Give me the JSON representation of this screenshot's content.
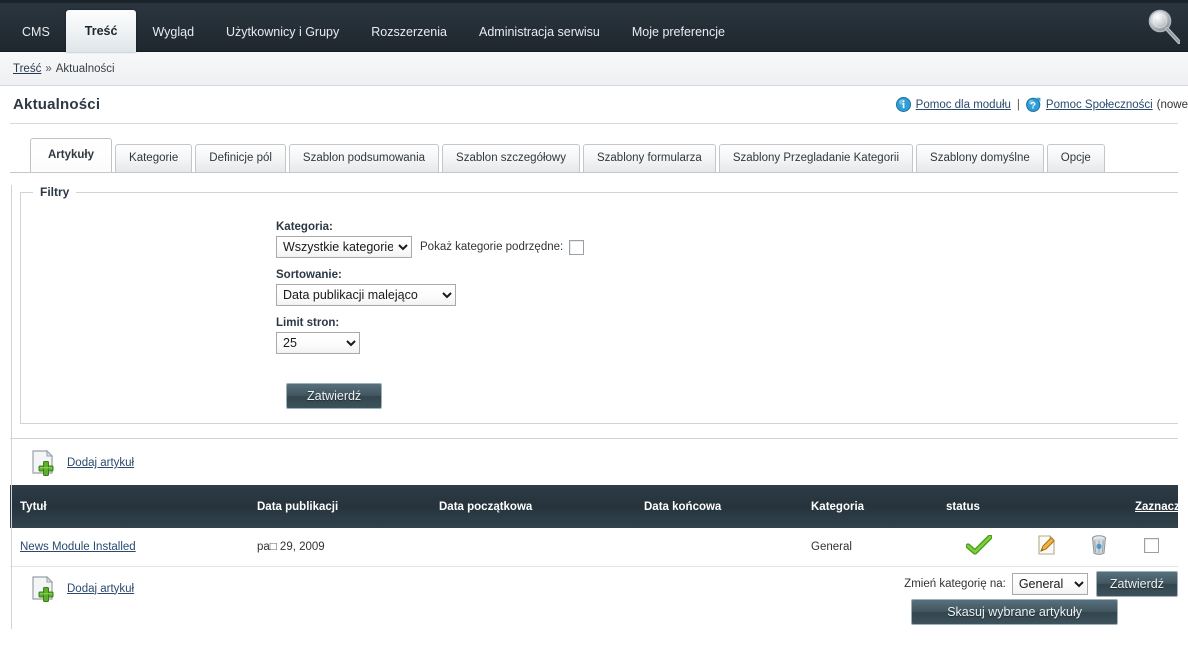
{
  "topnav": {
    "items": [
      {
        "label": "CMS",
        "active": false
      },
      {
        "label": "Treść",
        "active": true
      },
      {
        "label": "Wygląd",
        "active": false
      },
      {
        "label": "Użytkownicy i Grupy",
        "active": false
      },
      {
        "label": "Rozszerzenia",
        "active": false
      },
      {
        "label": "Administracja serwisu",
        "active": false
      },
      {
        "label": "Moje preferencje",
        "active": false
      }
    ],
    "search_icon": "search-icon"
  },
  "breadcrumb": {
    "root": "Treść",
    "separator": "»",
    "current": "Aktualności"
  },
  "header": {
    "title": "Aktualności",
    "help_module": "Pomoc dla modułu",
    "help_separator": "|",
    "help_community": "Pomoc Społeczności",
    "help_community_suffix": "(nowe",
    "info_icon": "info-icon",
    "question_icon": "question-icon"
  },
  "tabs": [
    {
      "label": "Artykuły",
      "active": true
    },
    {
      "label": "Kategorie",
      "active": false
    },
    {
      "label": "Definicje pól",
      "active": false
    },
    {
      "label": "Szablon podsumowania",
      "active": false
    },
    {
      "label": "Szablon szczegółowy",
      "active": false
    },
    {
      "label": "Szablony formularza",
      "active": false
    },
    {
      "label": "Szablony Przegladanie Kategorii",
      "active": false
    },
    {
      "label": "Szablony domyślne",
      "active": false
    },
    {
      "label": "Opcje",
      "active": false
    }
  ],
  "filters": {
    "legend": "Filtry",
    "category_label": "Kategoria:",
    "category_value": "Wszystkie kategorie",
    "show_sub_label": "Pokaż kategorie podrzędne:",
    "show_sub_checked": false,
    "sort_label": "Sortowanie:",
    "sort_value": "Data publikacji malejąco",
    "limit_label": "Limit stron:",
    "limit_value": "25",
    "submit_label": "Zatwierdź"
  },
  "add_article_top": {
    "label": "Dodaj artykuł",
    "icon": "add-document-icon"
  },
  "add_article_bottom": {
    "label": "Dodaj artykuł",
    "icon": "add-document-icon"
  },
  "table": {
    "columns": [
      "Tytuł",
      "Data publikacji",
      "Data początkowa",
      "Data końcowa",
      "Kategoria",
      "status",
      "",
      "",
      "Zaznacz"
    ],
    "select_all_label": "Zaznacz",
    "rows": [
      {
        "title": "News Module Installed",
        "publication_date": "pa□ 29, 2009",
        "start_date": "",
        "end_date": "",
        "category": "General",
        "status": "active",
        "status_icon": "green-check-icon",
        "edit_icon": "edit-pencil-icon",
        "delete_icon": "trash-icon",
        "checked": false
      }
    ]
  },
  "bulk_actions": {
    "change_category_label": "Zmień kategorię na:",
    "change_category_value": "General",
    "apply_label": "Zatwierdź",
    "delete_selected_label": "Skasuj wybrane artykuły"
  },
  "colors": {
    "nav_bg": "#263039",
    "table_header_bg": "#2e3c46",
    "link": "#2b4a6e",
    "button_bg": "#41565f",
    "check_green": "#5cb02c"
  }
}
